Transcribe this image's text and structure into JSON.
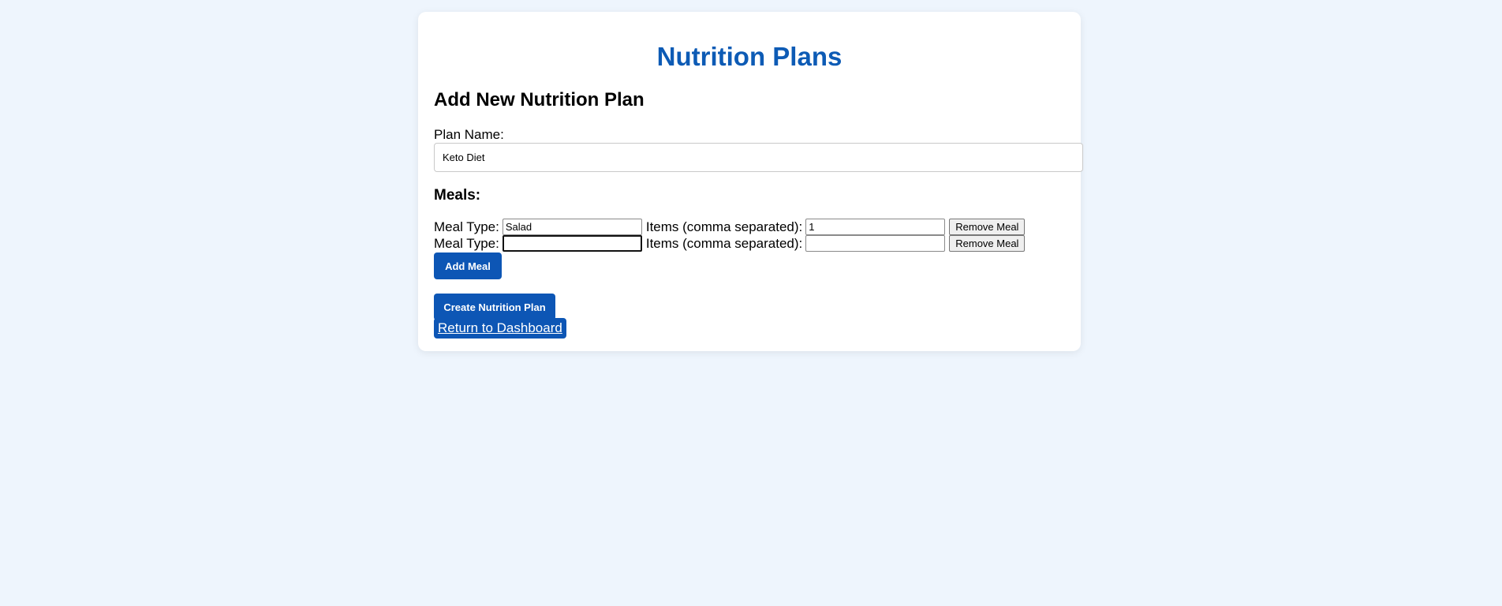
{
  "page": {
    "title": "Nutrition Plans"
  },
  "form": {
    "section_title": "Add New Nutrition Plan",
    "plan_name_label": "Plan Name:",
    "plan_name_value": "Keto Diet",
    "meals_title": "Meals:",
    "meals": [
      {
        "meal_type_label": "Meal Type:",
        "meal_type_value": "Salad",
        "items_label": "Items (comma separated):",
        "items_value": "1",
        "remove_label": "Remove Meal"
      },
      {
        "meal_type_label": "Meal Type:",
        "meal_type_value": "",
        "items_label": "Items (comma separated):",
        "items_value": "",
        "remove_label": "Remove Meal"
      }
    ],
    "add_meal_label": "Add Meal",
    "create_label": "Create Nutrition Plan",
    "return_label": "Return to Dashboard"
  },
  "colors": {
    "accent": "#0d56b5",
    "title": "#0d5bb5",
    "background": "#eef5fd"
  }
}
